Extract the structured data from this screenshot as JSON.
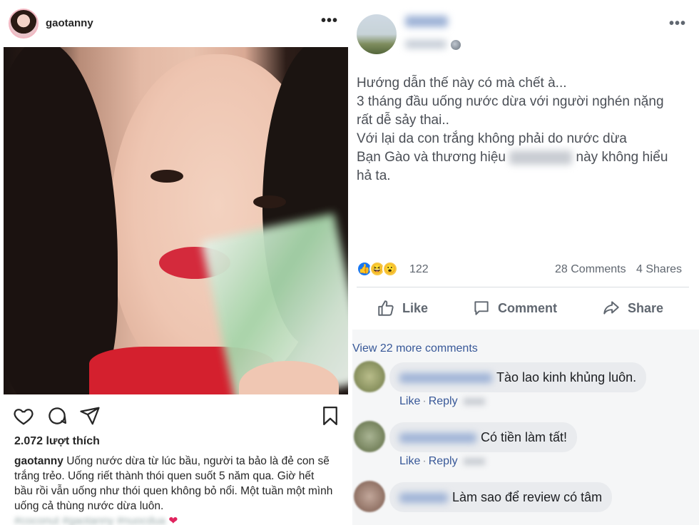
{
  "instagram": {
    "username": "gaotanny",
    "more": "•••",
    "likes": "2.072 lượt thích",
    "caption_user": "gaotanny",
    "caption_text": "Uống nước dừa từ lúc bầu, người ta bảo là đẻ con sẽ trắng trẻo. Uống riết thành thói quen suốt 5 năm qua. Giờ hết bầu rồi vẫn uống như thói quen không bỏ nổi. Một tuần một mình uống cả thùng nước dừa luôn.",
    "caption_hashtags": "#coconut #gaotanny #nuocdua",
    "heart": "❤",
    "icons": [
      "heart-icon",
      "comment-icon",
      "share-icon",
      "bookmark-icon"
    ]
  },
  "facebook": {
    "more": "•••",
    "post_lines": [
      "Hướng dẫn thế này có mà chết à...",
      "3 tháng đầu uống nước dừa với người nghén nặng",
      "rất dễ sảy thai..",
      "Với lại da con trắng không phải do nước dừa",
      "Bạn Gào và thương hiệu",
      "này không hiểu",
      "hả ta."
    ],
    "reaction_count": "122",
    "comments_count": "28 Comments",
    "shares_count": "4 Shares",
    "like_label": "Like",
    "comment_label": "Comment",
    "share_label": "Share",
    "view_more": "View 22 more comments",
    "comment_like": "Like",
    "comment_reply": "Reply",
    "comments": [
      {
        "text": "Tào lao kinh khủng luôn."
      },
      {
        "text": "Có tiền làm tất!"
      },
      {
        "text": "Làm sao để review có tâm"
      }
    ],
    "colors": {
      "brand": "#1877f2",
      "link": "#385898",
      "bubble": "#e9ebee"
    }
  }
}
